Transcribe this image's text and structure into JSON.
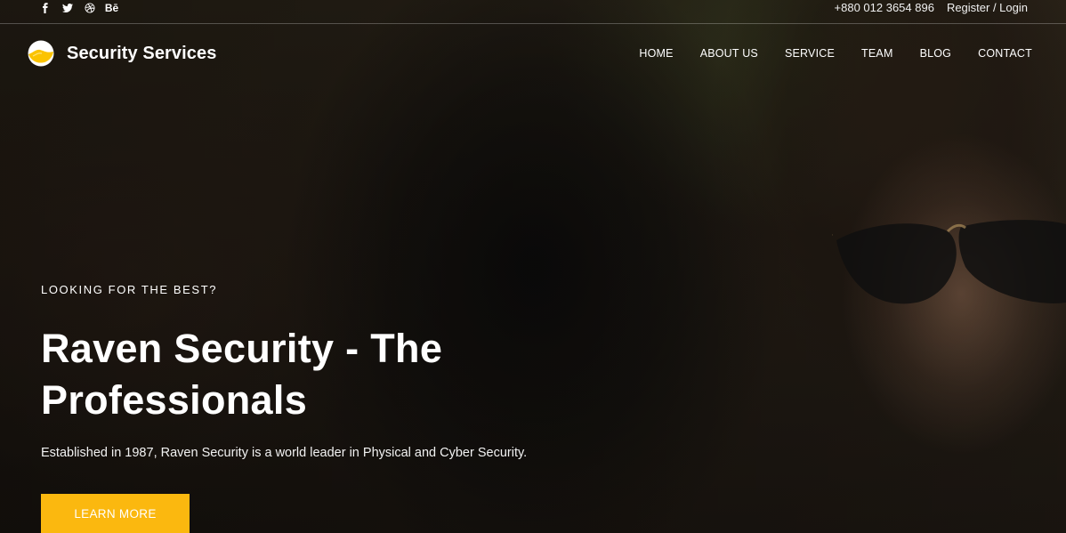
{
  "topbar": {
    "social": [
      "facebook-icon",
      "twitter-icon",
      "dribbble-icon",
      "behance-icon"
    ],
    "behance_text": "Bē",
    "phone": "+880 012 3654 896",
    "auth_link": "Register / Login"
  },
  "header": {
    "brand": "Security Services",
    "menu": [
      "HOME",
      "ABOUT US",
      "SERVICE",
      "TEAM",
      "BLOG",
      "CONTACT"
    ]
  },
  "hero": {
    "eyebrow": "LOOKING FOR THE BEST?",
    "title_line1": "Raven Security - The",
    "title_line2": "Professionals",
    "description": "Established in 1987, Raven Security is a world leader in Physical and Cyber Security.",
    "cta_label": "LEARN MORE"
  },
  "colors": {
    "accent": "#fbb80f",
    "text": "#ffffff"
  }
}
